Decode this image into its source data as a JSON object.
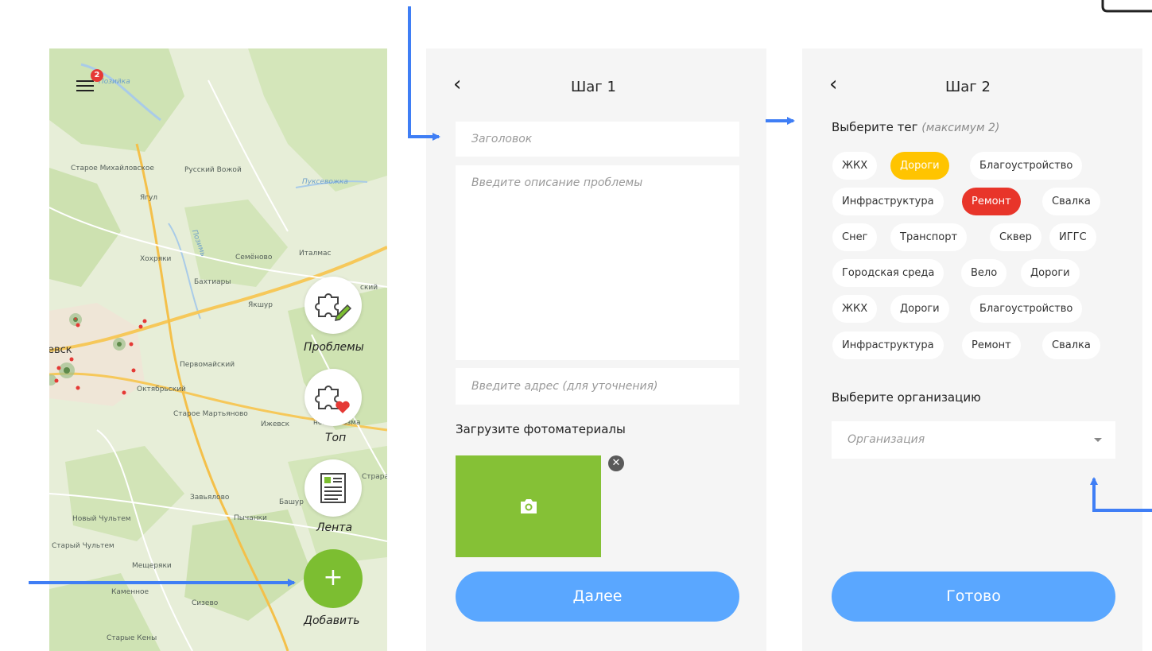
{
  "map": {
    "badge_count": "2",
    "places": [
      {
        "text": "Старое Михайловское",
        "cls": ""
      },
      {
        "text": "Русский Вожой",
        "cls": ""
      },
      {
        "text": "Ягул",
        "cls": ""
      },
      {
        "text": "Пуксевожка",
        "cls": "river"
      },
      {
        "text": "Хохряки",
        "cls": ""
      },
      {
        "text": "Семёново",
        "cls": ""
      },
      {
        "text": "Италмас",
        "cls": ""
      },
      {
        "text": "Бахтиары",
        "cls": ""
      },
      {
        "text": "Якшур",
        "cls": ""
      },
      {
        "text": "ский",
        "cls": ""
      },
      {
        "text": "Первомайский",
        "cls": ""
      },
      {
        "text": "Октябрьский",
        "cls": ""
      },
      {
        "text": "Старое Мартьяново",
        "cls": ""
      },
      {
        "text": "Ижевск",
        "cls": ""
      },
      {
        "text": "евск",
        "cls": "big"
      },
      {
        "text": "новая Казма",
        "cls": ""
      },
      {
        "text": "Страра",
        "cls": ""
      },
      {
        "text": "Завьялово",
        "cls": ""
      },
      {
        "text": "Башур",
        "cls": ""
      },
      {
        "text": "Пычанки",
        "cls": ""
      },
      {
        "text": "Новый Чультем",
        "cls": ""
      },
      {
        "text": "Старый Чультем",
        "cls": ""
      },
      {
        "text": "Мещеряки",
        "cls": ""
      },
      {
        "text": "Каменное",
        "cls": ""
      },
      {
        "text": "Сизево",
        "cls": ""
      },
      {
        "text": "Старые Кены",
        "cls": ""
      },
      {
        "text": "Позийка",
        "cls": "river"
      },
      {
        "text": "Позимь",
        "cls": "river"
      }
    ],
    "fab_problems_label": "Проблемы",
    "fab_top_label": "Топ",
    "fab_feed_label": "Лента",
    "fab_add_label": "Добавить",
    "fab_add_symbol": "+"
  },
  "step1": {
    "title": "Шаг 1",
    "back_symbol": "‹",
    "title_placeholder": "Заголовок",
    "description_placeholder": "Введите описание проблемы",
    "address_placeholder": "Введите адрес (для уточнения)",
    "upload_label": "Загрузите фотоматериалы",
    "remove_symbol": "✕",
    "next_button": "Далее"
  },
  "step2": {
    "title": "Шаг 2",
    "back_symbol": "‹",
    "tag_label": "Выберите тег",
    "tag_hint": "(максимум 2)",
    "tags": [
      {
        "label": "ЖКХ",
        "state": ""
      },
      {
        "label": "Дороги",
        "state": "yellow"
      },
      {
        "label": "Благоустройство",
        "state": ""
      },
      {
        "label": "Инфраструктура",
        "state": ""
      },
      {
        "label": "Ремонт",
        "state": "red"
      },
      {
        "label": "Свалка",
        "state": ""
      },
      {
        "label": "Снег",
        "state": ""
      },
      {
        "label": "Транспорт",
        "state": ""
      },
      {
        "label": "Сквер",
        "state": ""
      },
      {
        "label": "ИГГС",
        "state": ""
      },
      {
        "label": "Городская среда",
        "state": ""
      },
      {
        "label": "Вело",
        "state": ""
      },
      {
        "label": "Дороги",
        "state": ""
      },
      {
        "label": "ЖКХ",
        "state": ""
      },
      {
        "label": "Дороги",
        "state": ""
      },
      {
        "label": "Благоустройство",
        "state": ""
      },
      {
        "label": "Инфраструктура",
        "state": ""
      },
      {
        "label": "Ремонт",
        "state": ""
      },
      {
        "label": "Свалка",
        "state": ""
      }
    ],
    "org_label": "Выберите организацию",
    "org_placeholder": "Организация",
    "done_button": "Готово"
  },
  "colors": {
    "accent_blue": "#5aa7ff",
    "accent_green": "#7cbe31",
    "tag_yellow": "#ffc400",
    "tag_red": "#e8352a",
    "arrow_blue": "#3f7ef5"
  }
}
